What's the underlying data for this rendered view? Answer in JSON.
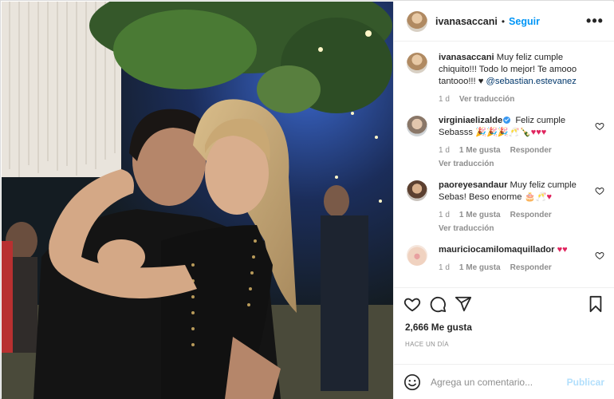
{
  "post": {
    "username": "ivanasaccani",
    "separator": "•",
    "follow_label": "Seguir",
    "more_label": "•••"
  },
  "caption": {
    "username": "ivanasaccani",
    "text": "Muy feliz cumple chiquito!!! Todo lo mejor! Te amooo tantooo!!! ♥",
    "mention": "@sebastian.estevanez",
    "age": "1 d",
    "translate_label": "Ver traducción"
  },
  "comments": [
    {
      "username": "virginiaelizalde",
      "verified": true,
      "text": "Feliz cumple Sebasss",
      "emojis": "🎉🎉🎉🥂🍾",
      "hearts": "♥♥♥",
      "age": "1 d",
      "likes": "1 Me gusta",
      "reply": "Responder",
      "translate": "Ver traducción"
    },
    {
      "username": "paoreyesandaur",
      "verified": false,
      "text": "Muy feliz cumple Sebas! Beso enorme",
      "emojis": "🎂🥂",
      "hearts": "♥",
      "age": "1 d",
      "likes": "1 Me gusta",
      "reply": "Responder",
      "translate": "Ver traducción"
    },
    {
      "username": "mauriciocamilomaquillador",
      "verified": false,
      "text": "",
      "emojis": "",
      "hearts": "♥♥",
      "age": "1 d",
      "likes": "1 Me gusta",
      "reply": "Responder",
      "translate": ""
    }
  ],
  "footer": {
    "likes": "2,666 Me gusta",
    "time_ago": "HACE UN DÍA",
    "comment_placeholder": "Agrega un comentario...",
    "publish_label": "Publicar"
  },
  "icons": [
    "heart-icon",
    "comment-icon",
    "share-icon",
    "bookmark-icon",
    "emoji-icon",
    "more-options-icon"
  ],
  "colors": {
    "link": "#0095f6",
    "mention": "#00376b",
    "heart": "#e0245e",
    "muted": "#8e8e8e",
    "publish_disabled": "#b2dffc"
  }
}
